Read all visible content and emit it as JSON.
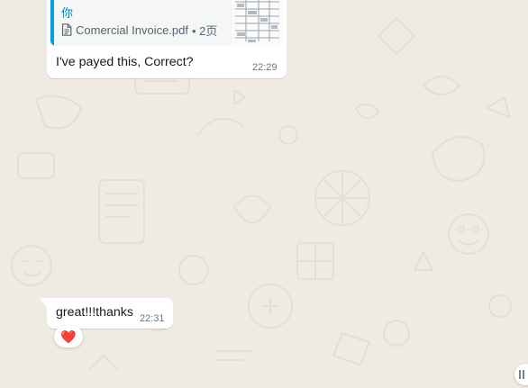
{
  "theme": {
    "wallpaper_color": "#efeae2",
    "bubble_color": "#ffffff",
    "quote_bar_color": "#06a0d8",
    "quote_author_color": "#0d83b9"
  },
  "messages": [
    {
      "quote": {
        "author": "你",
        "file_name": "Comercial Invoice.pdf",
        "file_meta": "• 2页",
        "file_icon": "document-icon",
        "thumbnail": "pdf-thumbnail"
      },
      "text": "I've payed this, Correct?",
      "time": "22:29"
    },
    {
      "text": "great!!!thanks",
      "time": "22:31",
      "reaction": "❤️"
    }
  ],
  "scroll_button": {
    "icon": "chevron-down-icon"
  }
}
